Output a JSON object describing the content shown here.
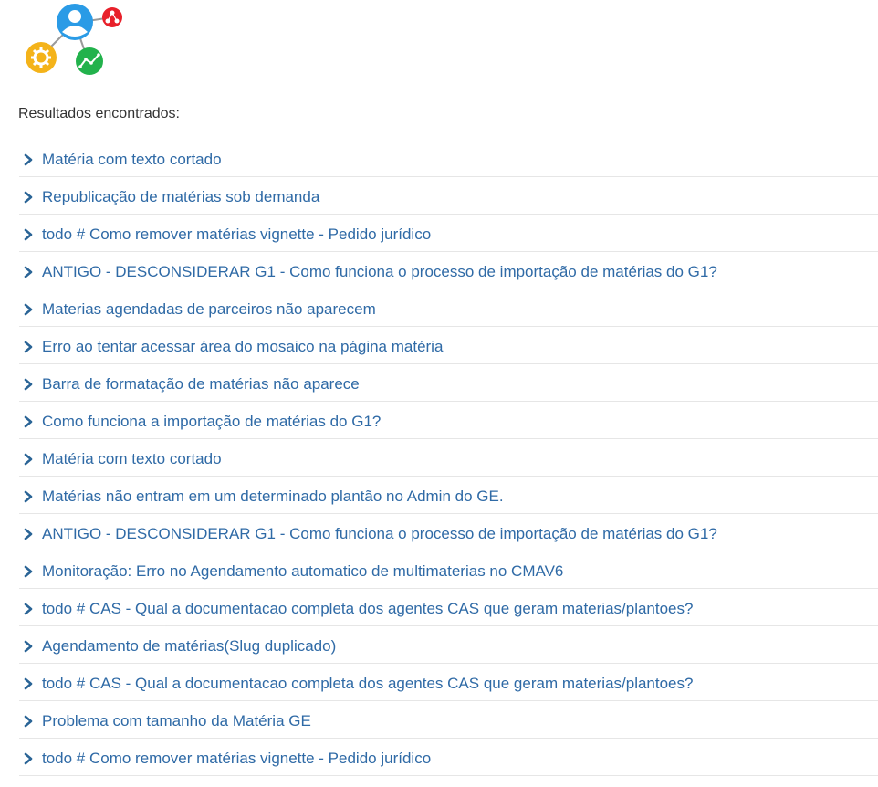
{
  "logo": {
    "icon": "user-network-logo"
  },
  "heading": "Resultados encontrados:",
  "results": [
    "Matéria com texto cortado",
    "Republicação de matérias sob demanda",
    "todo # Como remover matérias vignette - Pedido jurídico",
    "ANTIGO - DESCONSIDERAR G1 - Como funciona o processo de importação de matérias do G1?",
    "Materias agendadas de parceiros não aparecem",
    "Erro ao tentar acessar área do mosaico na página matéria",
    "Barra de formatação de matérias não aparece",
    "Como funciona a importação de matérias do G1?",
    "Matéria com texto cortado",
    "Matérias não entram em um determinado plantão no Admin do GE.",
    "ANTIGO - DESCONSIDERAR G1 - Como funciona o processo de importação de matérias do G1?",
    "Monitoração: Erro no Agendamento automatico de multimaterias no CMAV6",
    "todo # CAS - Qual a documentacao completa dos agentes CAS que geram materias/plantoes?",
    "Agendamento de matérias(Slug duplicado)",
    "todo # CAS - Qual a documentacao completa dos agentes CAS que geram materias/plantoes?",
    "Problema com tamanho da Matéria GE",
    "todo # Como remover matérias vignette - Pedido jurídico"
  ],
  "colors": {
    "link": "#2f6aa6",
    "divider": "#e6e6e6",
    "heading": "#333333"
  }
}
